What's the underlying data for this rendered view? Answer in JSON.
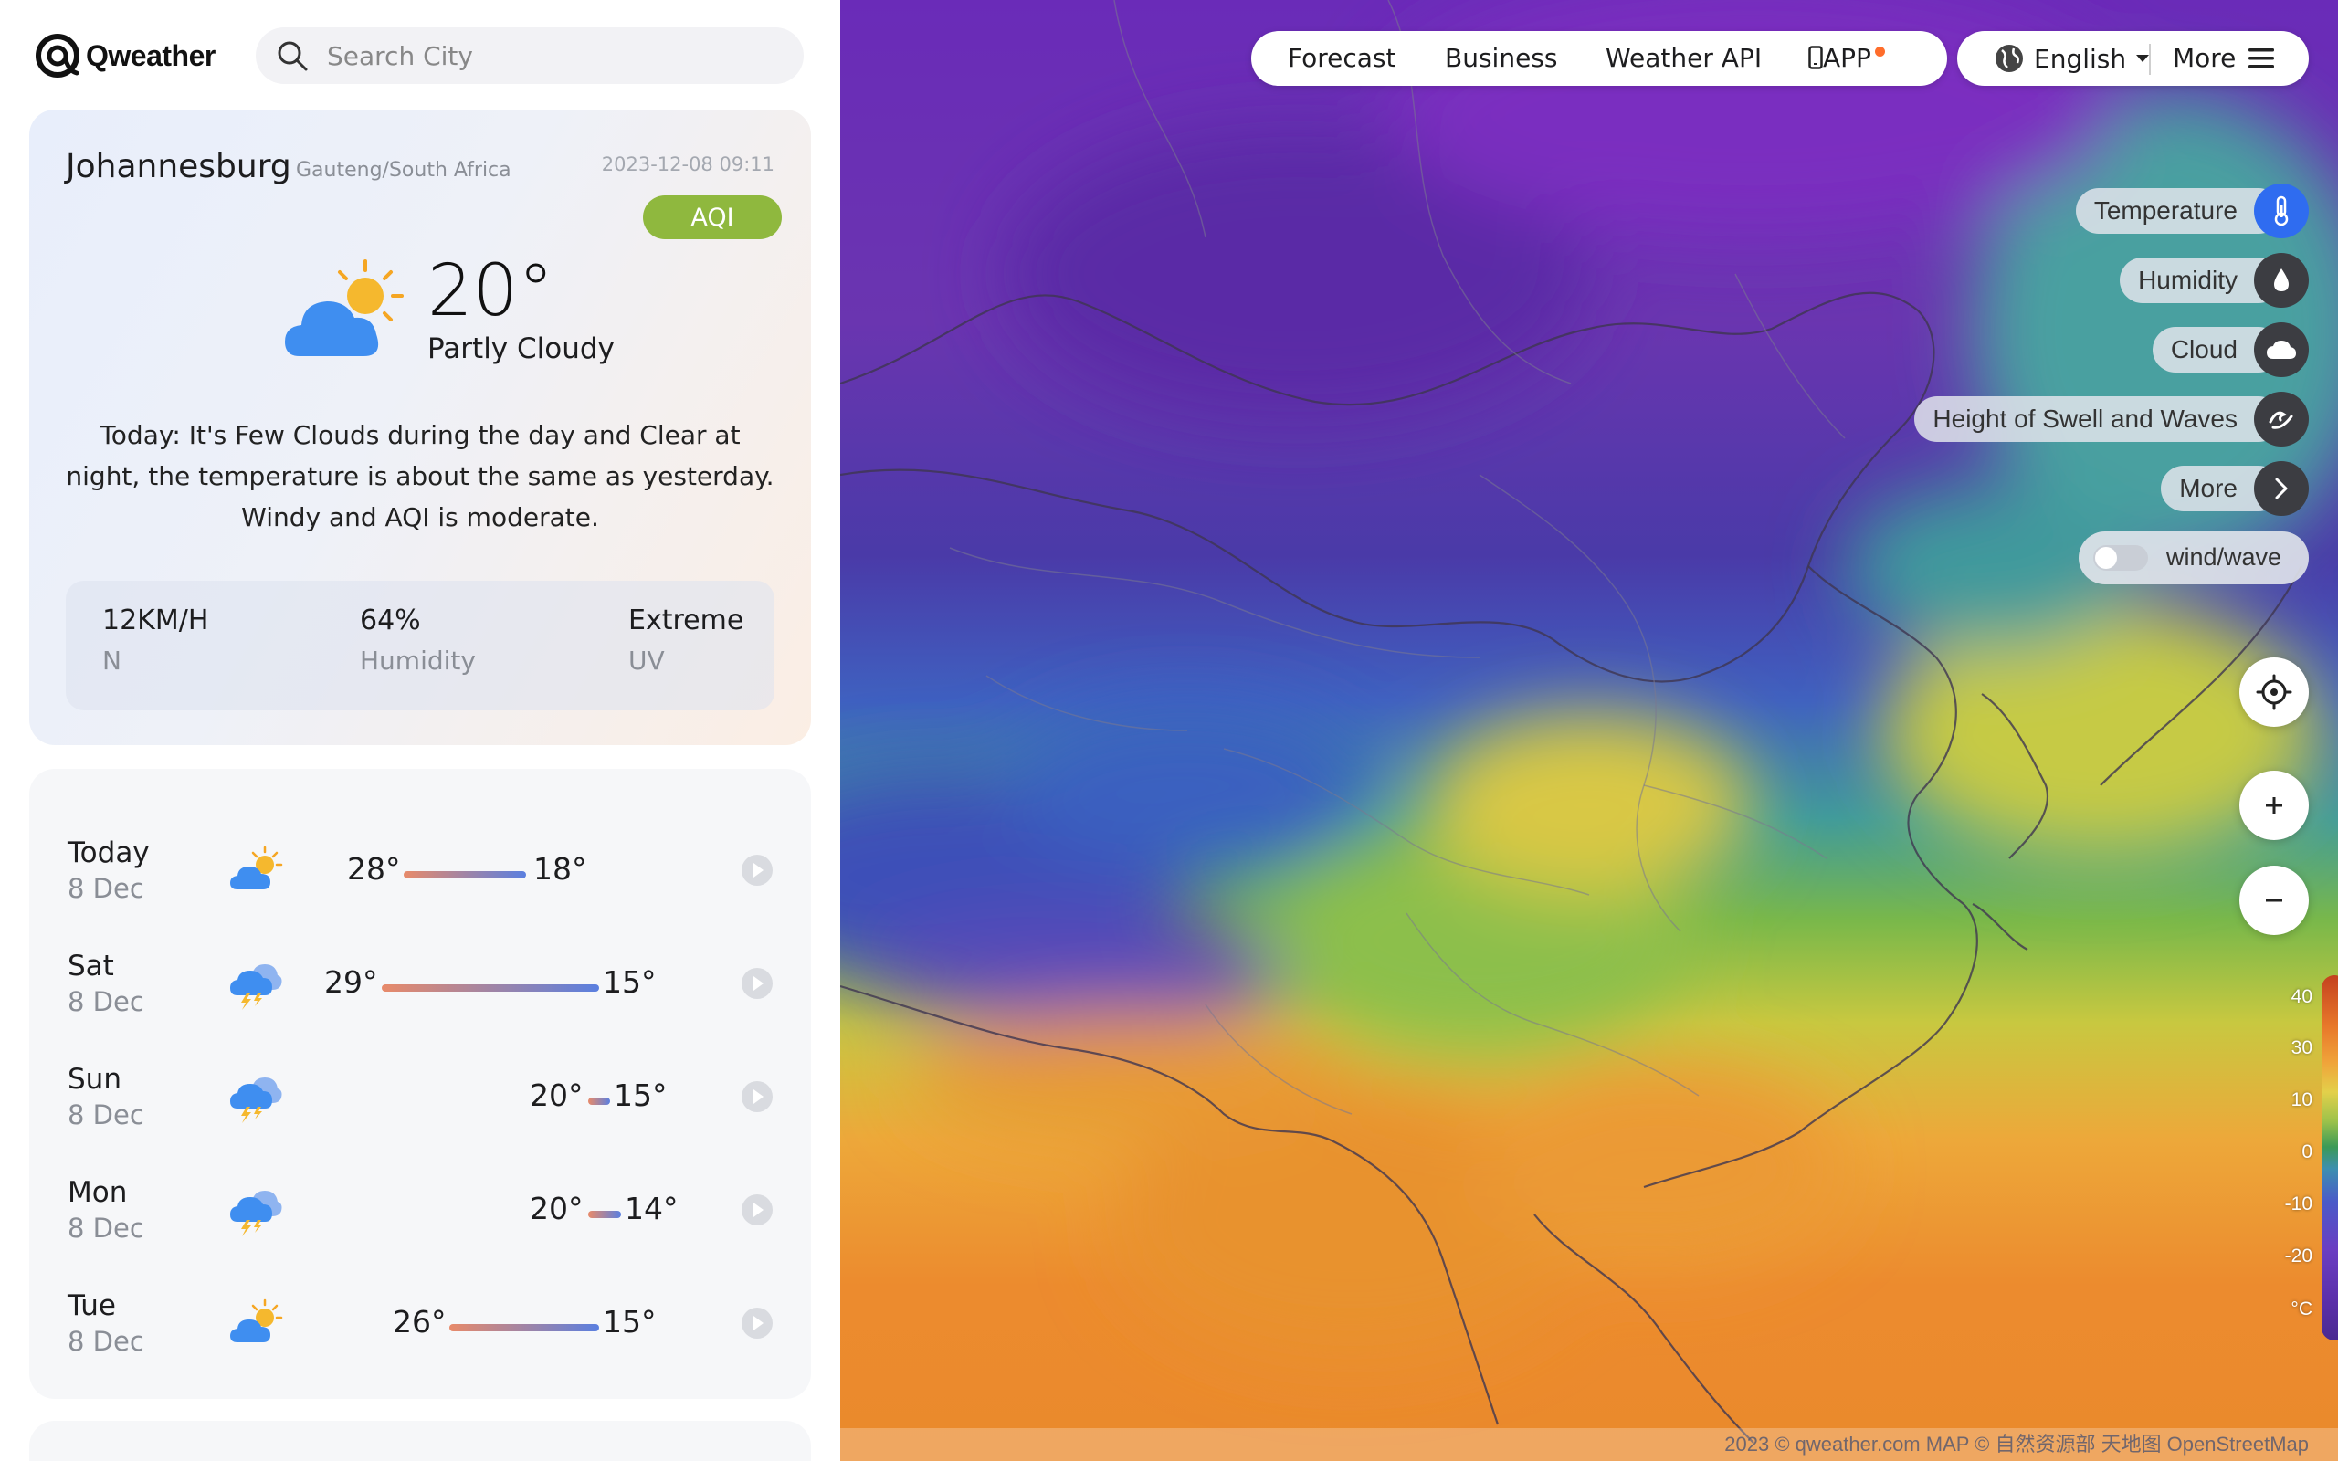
{
  "brand": {
    "name": "Qweather"
  },
  "search": {
    "placeholder": "Search City"
  },
  "current": {
    "city": "Johannesburg",
    "region": "Gauteng/South Africa",
    "observed": "2023-12-08 09:11",
    "aqi_label": "AQI",
    "temperature": "20°",
    "condition": "Partly Cloudy",
    "summary": "Today: It's Few Clouds during the day and Clear at night, the temperature is about the same as yesterday. Windy and AQI is moderate.",
    "stats": [
      {
        "value": "12KM/H",
        "label": "N"
      },
      {
        "value": "64%",
        "label": "Humidity"
      },
      {
        "value": "Extreme",
        "label": "UV"
      }
    ]
  },
  "forecast": [
    {
      "day": "Today",
      "date": "8 Dec",
      "icon": "partly-cloudy-icon",
      "high": "28°",
      "low": "18°"
    },
    {
      "day": "Sat",
      "date": "8 Dec",
      "icon": "thunderstorm-icon",
      "high": "29°",
      "low": "15°"
    },
    {
      "day": "Sun",
      "date": "8 Dec",
      "icon": "thunderstorm-icon",
      "high": "20°",
      "low": "15°"
    },
    {
      "day": "Mon",
      "date": "8 Dec",
      "icon": "thunderstorm-icon",
      "high": "20°",
      "low": "14°"
    },
    {
      "day": "Tue",
      "date": "8 Dec",
      "icon": "partly-cloudy-icon",
      "high": "26°",
      "low": "15°"
    }
  ],
  "nav": {
    "forecast": "Forecast",
    "business": "Business",
    "weather_api": "Weather API",
    "app": "APP"
  },
  "lang": {
    "current": "English",
    "more": "More"
  },
  "layers": [
    {
      "label": "Temperature",
      "icon": "thermometer-icon",
      "active": true
    },
    {
      "label": "Humidity",
      "icon": "droplet-icon",
      "active": false
    },
    {
      "label": "Cloud",
      "icon": "cloud-icon",
      "active": false
    },
    {
      "label": "Height of Swell and Waves",
      "icon": "wave-icon",
      "active": false
    },
    {
      "label": "More",
      "icon": "chevron-right-icon",
      "active": false
    }
  ],
  "wind_toggle": {
    "label": "wind/wave",
    "on": false
  },
  "legend": {
    "ticks": [
      "40",
      "30",
      "10",
      "0",
      "-10",
      "-20",
      "°C"
    ]
  },
  "attribution": "2023 © qweather.com MAP © 自然资源部 天地图 OpenStreetMap",
  "colors": {
    "accent": "#2f6cf0",
    "aqi": "#8fb83e",
    "app_dot": "#ff6d2b"
  }
}
